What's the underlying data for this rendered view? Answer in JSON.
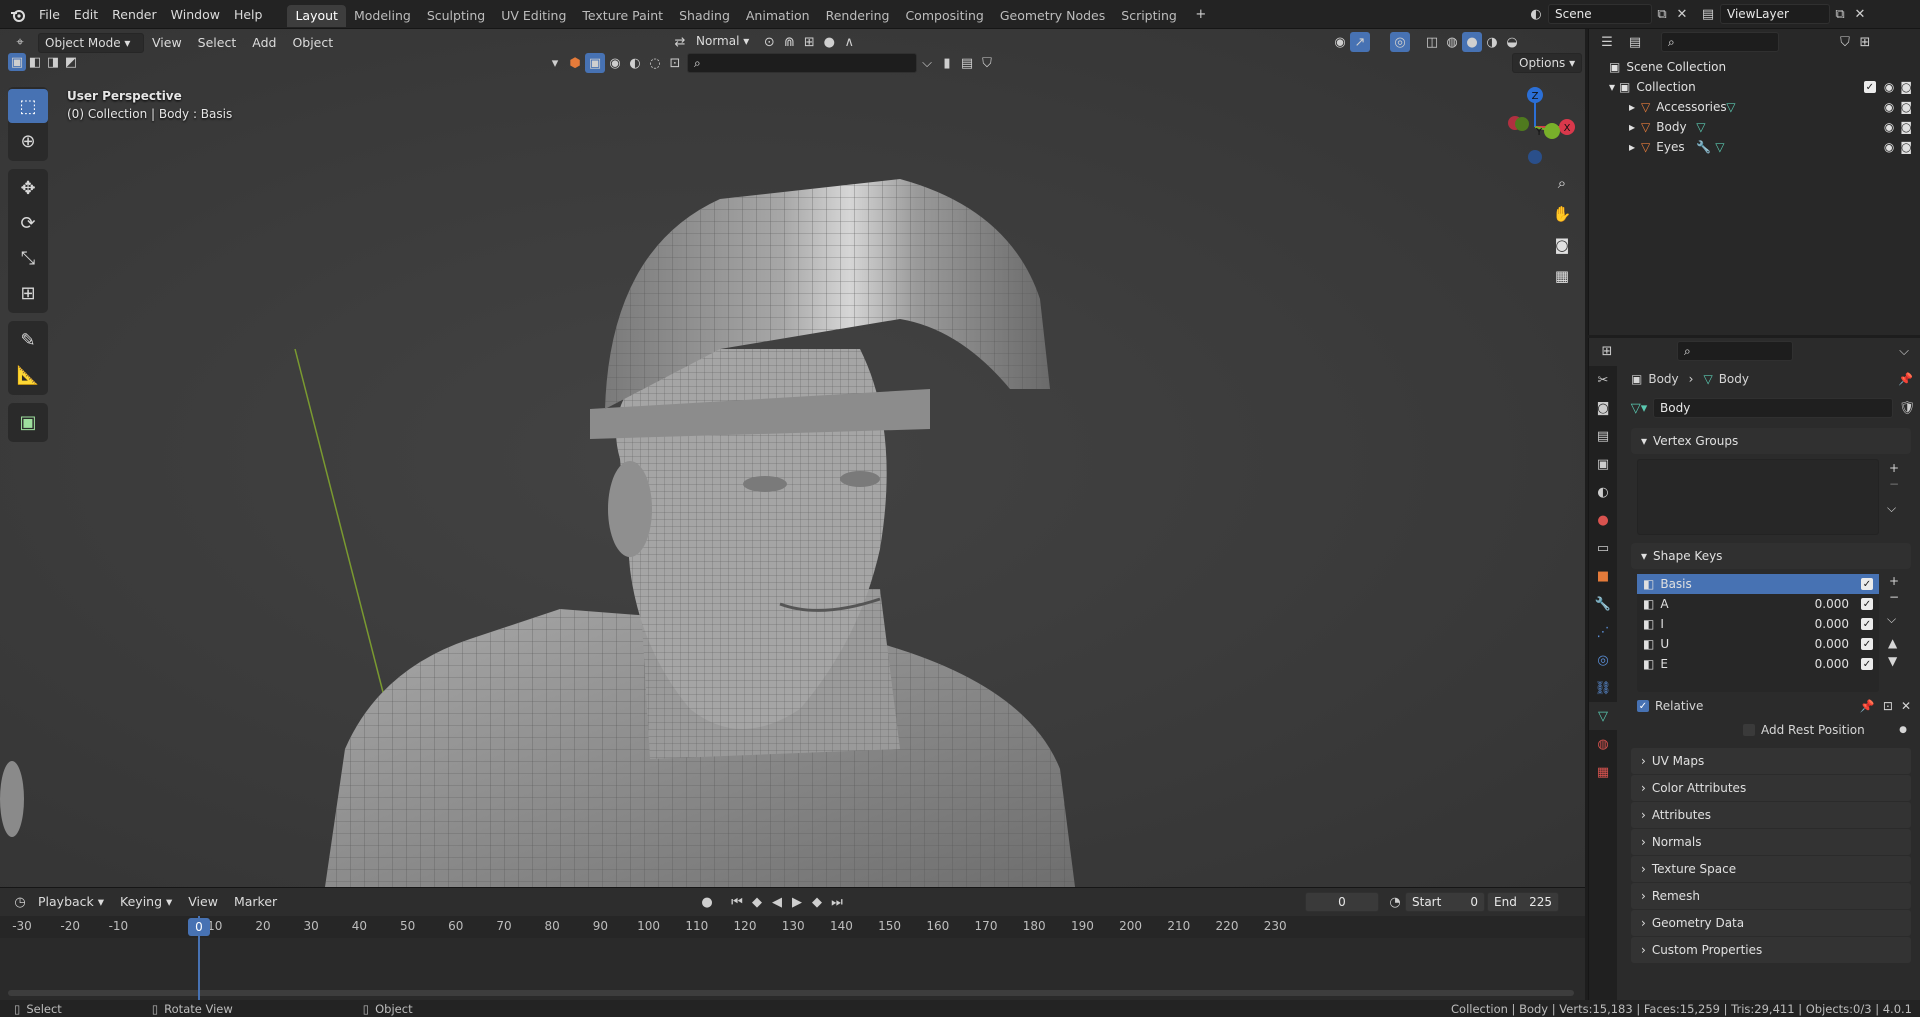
{
  "topbar": {
    "menu": [
      "File",
      "Edit",
      "Render",
      "Window",
      "Help"
    ],
    "workspaces": [
      "Layout",
      "Modeling",
      "Sculpting",
      "UV Editing",
      "Texture Paint",
      "Shading",
      "Animation",
      "Rendering",
      "Compositing",
      "Geometry Nodes",
      "Scripting"
    ],
    "active_workspace": "Layout",
    "scene": "Scene",
    "view_layer": "ViewLayer"
  },
  "viewport": {
    "mode": "Object Mode",
    "menus": [
      "View",
      "Select",
      "Add",
      "Object"
    ],
    "orientation": "Normal",
    "options_label": "Options",
    "info_line1": "User Perspective",
    "info_line2": "(0) Collection | Body : Basis",
    "gizmo": {
      "x": "X",
      "y": "Y",
      "z": "Z"
    }
  },
  "timeline": {
    "menus": [
      "Playback",
      "Keying",
      "View",
      "Marker"
    ],
    "current_frame": "0",
    "start_label": "Start",
    "start": "0",
    "end_label": "End",
    "end": "225",
    "ticks": [
      "-30",
      "-20",
      "-10",
      "0",
      "10",
      "20",
      "30",
      "40",
      "50",
      "60",
      "70",
      "80",
      "90",
      "100",
      "110",
      "120",
      "130",
      "140",
      "150",
      "160",
      "170",
      "180",
      "190",
      "200",
      "210",
      "220",
      "230"
    ]
  },
  "outliner": {
    "root": "Scene Collection",
    "collection": "Collection",
    "items": [
      "Accessories",
      "Body",
      "Eyes"
    ]
  },
  "properties": {
    "breadcrumb_object": "Body",
    "breadcrumb_data": "Body",
    "data_name": "Body",
    "vertex_groups_label": "Vertex Groups",
    "shape_keys_label": "Shape Keys",
    "shape_keys": [
      {
        "name": "Basis",
        "value": ""
      },
      {
        "name": "A",
        "value": "0.000"
      },
      {
        "name": "I",
        "value": "0.000"
      },
      {
        "name": "U",
        "value": "0.000"
      },
      {
        "name": "E",
        "value": "0.000"
      }
    ],
    "relative_label": "Relative",
    "add_rest_label": "Add Rest Position",
    "panels": [
      "UV Maps",
      "Color Attributes",
      "Attributes",
      "Normals",
      "Texture Space",
      "Remesh",
      "Geometry Data",
      "Custom Properties"
    ]
  },
  "status": {
    "select": "Select",
    "rotate": "Rotate View",
    "object": "Object",
    "stats": "Collection | Body | Verts:15,183 | Faces:15,259 | Tris:29,411 | Objects:0/3 | 4.0.1"
  },
  "colors": {
    "accent": "#4772b3",
    "header": "#232323"
  }
}
